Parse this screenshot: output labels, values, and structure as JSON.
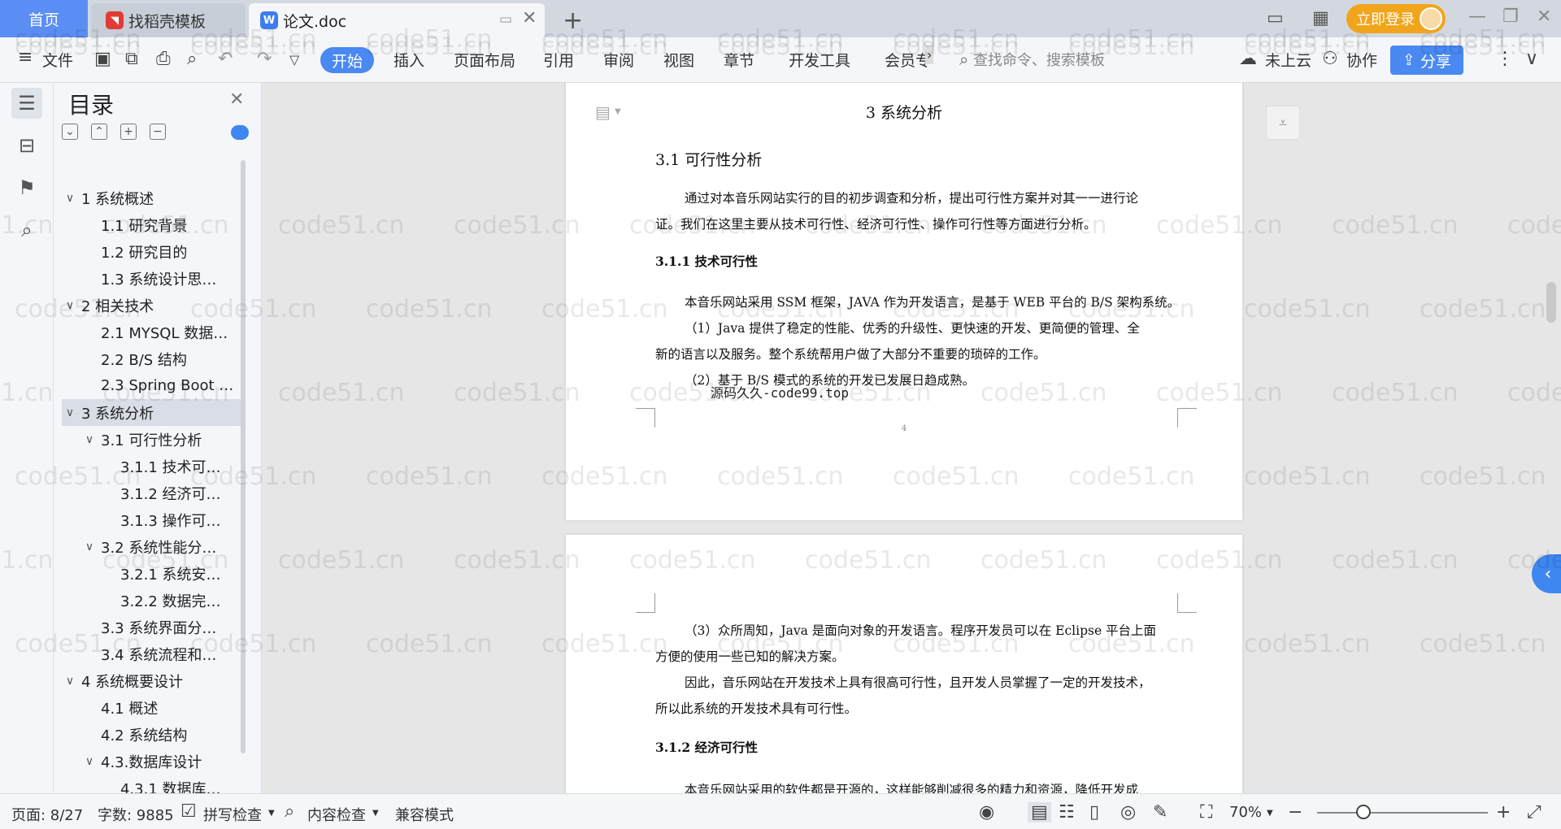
{
  "titlebar": {
    "tab_home": "首页",
    "tab_template": "找稻壳模板",
    "tab_doc": "论文.doc",
    "login": "立即登录"
  },
  "toolbar": {
    "file": "文件",
    "menus": [
      "开始",
      "插入",
      "页面布局",
      "引用",
      "审阅",
      "视图",
      "章节",
      "开发工具",
      "会员专"
    ],
    "search_placeholder": "查找命令、搜索模板",
    "cloud": "未上云",
    "collab": "协作",
    "share": "分享"
  },
  "toc": {
    "title": "目录",
    "items": [
      {
        "label": "1 系统概述",
        "caret": "∨"
      },
      {
        "label": "1.1  研究背景",
        "caret": ""
      },
      {
        "label": "1.2 研究目的",
        "caret": ""
      },
      {
        "label": "1.3 系统设计思…",
        "caret": ""
      },
      {
        "label": "2 相关技术",
        "caret": "∨"
      },
      {
        "label": "2.1 MYSQL 数据…",
        "caret": ""
      },
      {
        "label": "2.2 B/S 结构",
        "caret": ""
      },
      {
        "label": "2.3 Spring Boot …",
        "caret": ""
      },
      {
        "label": "3 系统分析",
        "caret": "∨"
      },
      {
        "label": "3.1 可行性分析",
        "caret": "∨"
      },
      {
        "label": "3.1.1 技术可…",
        "caret": ""
      },
      {
        "label": "3.1.2 经济可…",
        "caret": ""
      },
      {
        "label": "3.1.3 操作可…",
        "caret": ""
      },
      {
        "label": "3.2 系统性能分…",
        "caret": "∨"
      },
      {
        "label": "3.2.1  系统安…",
        "caret": ""
      },
      {
        "label": "3.2.2  数据完…",
        "caret": ""
      },
      {
        "label": "3.3 系统界面分…",
        "caret": ""
      },
      {
        "label": "3.4 系统流程和…",
        "caret": ""
      },
      {
        "label": "4 系统概要设计",
        "caret": "∨"
      },
      {
        "label": "4.1 概述",
        "caret": ""
      },
      {
        "label": "4.2 系统结构",
        "caret": ""
      },
      {
        "label": "4.3.数据库设计",
        "caret": "∨"
      },
      {
        "label": "4.3.1 数据库…",
        "caret": ""
      }
    ]
  },
  "document": {
    "page1": {
      "header": "3 系统分析",
      "h2": "3.1 可行性分析",
      "p1_line1": "通过对本音乐网站实行的目的初步调查和分析，提出可行性方案并对其一一进行论",
      "p1_line2": "证。我们在这里主要从技术可行性、经济可行性、操作可行性等方面进行分析。",
      "h3": "3.1.1 技术可行性",
      "p2": "本音乐网站采用 SSM 框架，JAVA 作为开发语言，是基于 WEB 平台的 B/S 架构系统。",
      "p3_line1": "（1）Java 提供了稳定的性能、优秀的升级性、更快速的开发、更简便的管理、全",
      "p3_line2": "新的语言以及服务。整个系统帮用户做了大部分不重要的琐碎的工作。",
      "p4": "（2）基于 B/S 模式的系统的开发已发展日趋成熟。",
      "overlay": "源码久久-code99.top",
      "page_number": "4"
    },
    "page2": {
      "p1_line1": "（3）众所周知，Java 是面向对象的开发语言。程序开发员可以在 Eclipse 平台上面",
      "p1_line2": "方便的使用一些已知的解决方案。",
      "p2_line1": "因此，音乐网站在开发技术上具有很高可行性，且开发人员掌握了一定的开发技术，",
      "p2_line2": "所以此系统的开发技术具有可行性。",
      "h3": "3.1.2 经济可行性",
      "p3_partial": "本音乐网站采用的软件都是开源的，这样能够削减很多的精力和资源，降低开发成"
    }
  },
  "watermark": "code51.cn",
  "statusbar": {
    "page": "页面: 8/27",
    "words": "字数: 9885",
    "spell": "拼写检查",
    "content_check": "内容检查",
    "compat": "兼容模式",
    "zoom": "70%",
    "zoom_level_percent": 70
  },
  "colors": {
    "accent": "#4a88f2",
    "login": "#f1a51c"
  }
}
